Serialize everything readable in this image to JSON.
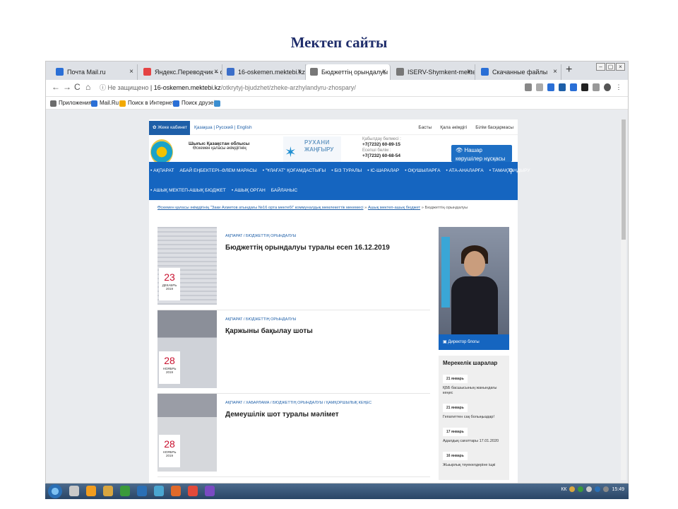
{
  "slide": {
    "title": "Мектеп сайты"
  },
  "browser": {
    "tabs": [
      {
        "label": "Почта Mail.ru",
        "close": "×",
        "color": "#2a6fd6",
        "active": false
      },
      {
        "label": "Яндекс.Переводчик – словарь и…",
        "close": "×",
        "color": "#e54343",
        "active": false
      },
      {
        "label": "16-oskemen.mektebi.kz - 42 тыс…",
        "close": "×",
        "color": "#3b6ec9",
        "active": false
      },
      {
        "label": "Бюджеттің орындалуы » Өскем…",
        "close": "×",
        "color": "#777777",
        "active": true
      },
      {
        "label": "ISERV-Shymkent-mektebi.kz - Пр…",
        "close": "×",
        "color": "#777777",
        "active": false
      },
      {
        "label": "Скачанные файлы",
        "close": "×",
        "color": "#2a6fd6",
        "active": false
      }
    ],
    "new_tab": "+",
    "window_buttons": [
      "–",
      "▢",
      "×"
    ],
    "nav": {
      "back": "←",
      "forward": "→",
      "reload": "C",
      "home": "⌂"
    },
    "url": {
      "security": "ⓘ Не защищено",
      "host": "16-oskemen.mektebi.kz",
      "path": "/otkrytyj-bjudzhet/zheke-arzhylandyru-zhospary/"
    },
    "bookmarks": [
      {
        "label": "Приложения",
        "color": "#6b6b6b"
      },
      {
        "label": "Mail.Ru",
        "color": "#2a6fd6"
      },
      {
        "label": "Поиск в Интернете",
        "color": "#f2a900"
      },
      {
        "label": "Поиск друзей",
        "color": "#2a6fd6"
      },
      {
        "label": "",
        "color": "#3b8fd1"
      }
    ]
  },
  "site": {
    "cabinet": "✿ Жеке кабинет",
    "langs": "Қазақша | Русский | English",
    "toplinks": [
      "Басты",
      "Қала әкімдігі",
      "Білім басқармасы"
    ],
    "region_line1": "Шығыс Қазақстан облысы",
    "region_line2": "Өскемен қаласы әкімдігінің",
    "rukhani_1": "РУХАНИ",
    "rukhani_2": "ЖАҢҒЫРУ",
    "contacts": [
      {
        "label": "Қабылдау бөлмесі :",
        "phone": "+7(7232) 60-89-15"
      },
      {
        "label": "Есепші бөлім :",
        "phone": "+7(7232) 60-68-54"
      }
    ],
    "blind_button": "👁 Нашар көрушілер нұсқасы",
    "nav_row1": [
      "• АҚПАРАТ",
      "АБАЙ ЕҢБЕКТЕРІ–ӘЛЕМ МАРАСЫ",
      "• \"ҰЛАҒАТ\" ҚОҒАМДАСТЫҒЫ",
      "• БІЗ ТУРАЛЫ",
      "• ІС-ШАРАЛАР",
      "• ОҚУШЫЛАРҒА",
      "• АТА-АНАЛАРҒА",
      "• ТАМАҚТАНДЫРУ"
    ],
    "nav_row2": [
      "• АШЫҚ МЕКТЕП-АШЫҚ БЮДЖЕТ",
      "• АШЫҚ ОРГАН",
      "БАЙЛАНЫС"
    ],
    "search_icon": "⚲",
    "breadcrumb_link1": "Өскемен қаласы әкімдігінің \"Заки Ахметов атындағы №16 орта мектебі\" коммуналдық мемлекеттік мекемесі",
    "breadcrumb_link2": "Ашық мектеп-ашық бюджет",
    "breadcrumb_current": "Бюджеттің орындалуы",
    "articles": [
      {
        "category": "АҚПАРАТ / БЮДЖЕТТІҢ ОРЫНДАЛУЫ",
        "title": "Бюджеттің орындалуы туралы есеп 16.12.2019",
        "day": "23",
        "month": "ДЕКАБРЬ",
        "year": "2019"
      },
      {
        "category": "АҚПАРАТ / БЮДЖЕТТІҢ ОРЫНДАЛУЫ",
        "title": "Қаржыны бақылау шоты",
        "day": "28",
        "month": "НОЯБРЬ",
        "year": "2019"
      },
      {
        "category": "АҚПАРАТ / ХАБАРЛАМА / БЮДЖЕТТІҢ ОРЫНДАЛУЫ / ҚАМҚОРШЫЛЫҚ КЕҢЕС",
        "title": "Демеушілік шот туралы мәлімет",
        "day": "28",
        "month": "НОЯБРЬ",
        "year": "2019"
      }
    ],
    "director_caption": "▣ Директор блогы",
    "events_title": "Мерекелік шаралар",
    "events": [
      {
        "date": "21 январь",
        "text": "ҚББ басшысының жанындағы кеңес"
      },
      {
        "date": "21 январь",
        "text": "Гепатиттен сақ болыңыздар!"
      },
      {
        "date": "17 январь",
        "text": "Адалдық сағаттары 17.01.2020"
      },
      {
        "date": "16 январь",
        "text": "Жыырлық тәуекелдеріне іщкі"
      }
    ]
  },
  "taskbar": {
    "items": [
      "#c9c9c9",
      "#f29d1f",
      "#d9a640",
      "#3a9a3a",
      "#2a6fb5",
      "#4aa6d1",
      "#e06a2a",
      "#e24a3a",
      "#7a4ac2"
    ],
    "lang": "КК",
    "time": "15:49"
  }
}
